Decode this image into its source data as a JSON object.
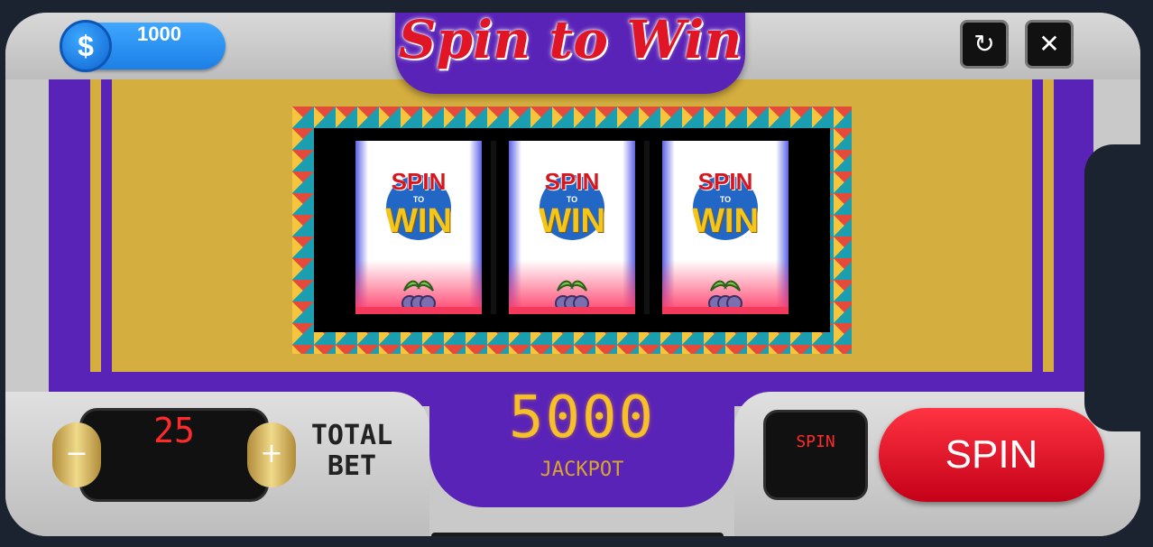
{
  "balance": {
    "currency_symbol": "$",
    "amount": "1000"
  },
  "title": "Spin to Win",
  "top_buttons": {
    "refresh_icon": "refresh-icon",
    "close_icon": "close-icon",
    "refresh_glyph": "↻",
    "close_glyph": "✕"
  },
  "reels": [
    {
      "top": {
        "spin": "SPIN",
        "to": "TO",
        "win": "WIN"
      },
      "bottom_symbol": "grapes"
    },
    {
      "top": {
        "spin": "SPIN",
        "to": "TO",
        "win": "WIN"
      },
      "bottom_symbol": "grapes"
    },
    {
      "top": {
        "spin": "SPIN",
        "to": "TO",
        "win": "WIN"
      },
      "bottom_symbol": "grapes"
    }
  ],
  "jackpot": {
    "value": "5000",
    "label": "JACKPOT"
  },
  "bet": {
    "value": "25",
    "minus": "−",
    "plus": "+",
    "label_line1": "TOTAL",
    "label_line2": "BET"
  },
  "spin_display": "SPIN",
  "spin_button": "SPIN",
  "colors": {
    "purple": "#5a23b8",
    "gold": "#d4ae3f",
    "red": "#d7171f",
    "blue": "#1c7fe6"
  }
}
